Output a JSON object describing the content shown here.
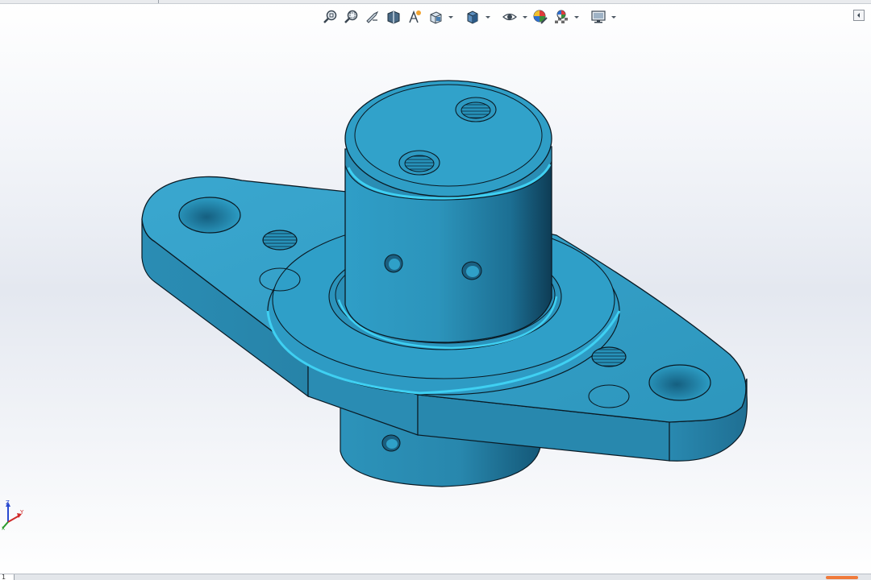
{
  "colors": {
    "model_base": "#2f9bc3",
    "model_dark": "#0f3f5a",
    "edge": "#0a1a24"
  },
  "hud_toolbar": {
    "icons": [
      "zoom-to-fit-icon",
      "zoom-to-area-icon",
      "previous-view-icon",
      "section-view-icon",
      "dynamic-annotation-icon",
      "view-orientation-icon",
      "display-style-icon",
      "hide-show-items-icon",
      "edit-appearance-icon",
      "apply-scene-icon",
      "view-settings-icon"
    ]
  },
  "triad": {
    "x_label": "X",
    "y_label": "Y",
    "z_label": "Z"
  },
  "bottom_bar": {
    "tab_label": "1"
  }
}
